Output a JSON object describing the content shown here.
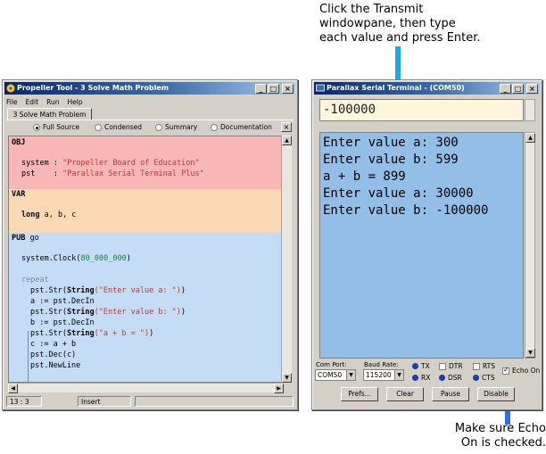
{
  "annotations": {
    "top_lines": [
      "Click the Transmit",
      "windowpane, then type",
      "each value and press Enter."
    ],
    "bottom_lines": [
      "Make sure Echo",
      "On is checked."
    ],
    "arrow_color": "#1aa7ec",
    "arrow2_color": "#2f6fe4"
  },
  "propeller": {
    "title": "Propeller Tool - 3 Solve Math Problem",
    "menu": [
      "File",
      "Edit",
      "Run",
      "Help"
    ],
    "tab": "3 Solve Math Problem",
    "views": [
      "Full Source",
      "Condensed",
      "Summary",
      "Documentation"
    ],
    "selected_view": "Full Source",
    "code": {
      "obj_kw": "OBJ",
      "obj_lines": [
        {
          "name": "system",
          "sep": " : ",
          "value": "\"Propeller Board of Education\""
        },
        {
          "name": "pst   ",
          "sep": " : ",
          "value": "\"Parallax Serial Terminal Plus\""
        }
      ],
      "var_kw": "VAR",
      "var_type": "long",
      "var_names": " a, b, c",
      "pub_kw": "PUB",
      "pub_name": " go",
      "clock_pre": "system.Clock(",
      "clock_num": "80_000_000",
      "clock_post": ")",
      "repeat_kw": "repeat",
      "str1_pre": "pst.Str(",
      "str1_fn": "String",
      "str1_arg": "(\"Enter value a: \")",
      "str1_post": ")",
      "line_a": "a := pst.DecIn",
      "str2_pre": "pst.Str(",
      "str2_fn": "String",
      "str2_arg": "(\"Enter value b: \")",
      "str2_post": ")",
      "line_b": "b := pst.DecIn",
      "str3_pre": "pst.Str(",
      "str3_fn": "String",
      "str3_arg": "(\"a + b = \")",
      "str3_post": ")",
      "line_c": "c := a + b",
      "line_dec": "pst.Dec(c)",
      "line_nl": "pst.NewLine"
    },
    "status": {
      "position": "13 : 3",
      "mode": "Insert"
    }
  },
  "terminal": {
    "title": "Parallax Serial Terminal - (COM50)",
    "transmit_text": "-100000",
    "receive_lines": [
      "Enter value a: 300",
      "Enter value b: 599",
      "a + b = 899",
      "Enter value a: 30000",
      "Enter value b: -100000"
    ],
    "com_port_label": "Com Port:",
    "com_port_value": "COM50",
    "baud_label": "Baud Rate:",
    "baud_value": "115200",
    "signals": [
      "TX",
      "RX",
      "DTR",
      "DSR",
      "RTS",
      "CTS"
    ],
    "echo_label": "Echo On",
    "echo_on": true,
    "buttons": [
      "Prefs...",
      "Clear",
      "Pause",
      "Disable"
    ]
  }
}
